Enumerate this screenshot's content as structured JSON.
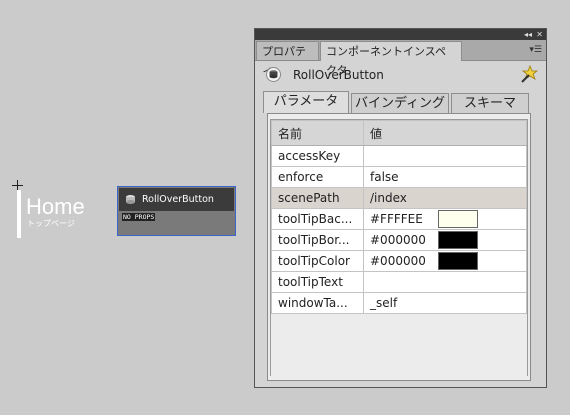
{
  "stage": {
    "home_title": "Home",
    "home_subtitle": "トップページ",
    "rollover_title": "RollOverButton",
    "rollover_props": "NO PROPS"
  },
  "panel": {
    "tabs": [
      "プロパティ",
      "コンポーネントインスペクタ"
    ],
    "collapse_icon": "double-chevron-left-icon",
    "close_icon": "close-icon",
    "menu_icon": "panel-menu-icon",
    "component_name": "RollOverButton",
    "subtabs": [
      "パラメータ",
      "バインディング",
      "スキーマ"
    ],
    "grid": {
      "headers": [
        "名前",
        "値"
      ],
      "rows": [
        {
          "name": "accessKey",
          "value": "",
          "color": ""
        },
        {
          "name": "enforce",
          "value": "false",
          "color": ""
        },
        {
          "name": "scenePath",
          "value": "/index",
          "color": ""
        },
        {
          "name": "toolTipBac...",
          "value": "#FFFFEE",
          "color": "#FFFFEE"
        },
        {
          "name": "toolTipBor...",
          "value": "#000000",
          "color": "#000000"
        },
        {
          "name": "toolTipColor",
          "value": "#000000",
          "color": "#000000"
        },
        {
          "name": "toolTipText",
          "value": "",
          "color": ""
        },
        {
          "name": "windowTa...",
          "value": "_self",
          "color": ""
        }
      ],
      "selected_row": 2
    }
  },
  "colors": {
    "stage_bg": "#cbcbcb",
    "selection_border": "#3a66c8"
  }
}
